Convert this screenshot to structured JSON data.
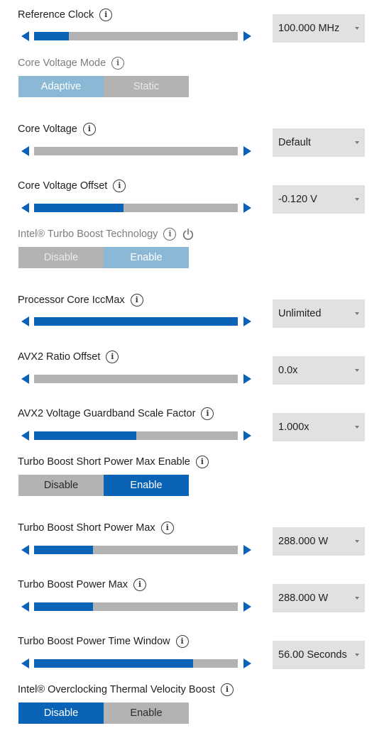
{
  "colors": {
    "accent": "#0b63b7",
    "track": "#b3b3b3",
    "select_bg": "#e1e1e1",
    "disabled_accent": "#8bb8d5"
  },
  "settings": [
    {
      "label": "Reference Clock",
      "fill": 0.17,
      "value": "100.000 MHz"
    },
    {
      "label": "Core Voltage Mode",
      "options": [
        "Adaptive",
        "Static"
      ],
      "selected": "Adaptive",
      "disabled": true
    },
    {
      "label": "Core Voltage",
      "fill": 0.0,
      "value": "Default"
    },
    {
      "label": "Core Voltage Offset",
      "fill": 0.44,
      "value": "-0.120 V"
    },
    {
      "label": "Intel® Turbo Boost Technology",
      "options": [
        "Disable",
        "Enable"
      ],
      "selected": "Enable",
      "disabled": true,
      "power_icon": "power-icon"
    },
    {
      "label": "Processor Core IccMax",
      "fill": 1.0,
      "value": "Unlimited"
    },
    {
      "label": "AVX2 Ratio Offset",
      "fill": 0.0,
      "value": "0.0x"
    },
    {
      "label": "AVX2 Voltage Guardband Scale Factor",
      "fill": 0.5,
      "value": "1.000x"
    },
    {
      "label": "Turbo Boost Short Power Max Enable",
      "options": [
        "Disable",
        "Enable"
      ],
      "selected": "Enable"
    },
    {
      "label": "Turbo Boost Short Power Max",
      "fill": 0.29,
      "value": "288.000 W"
    },
    {
      "label": "Turbo Boost Power Max",
      "fill": 0.29,
      "value": "288.000 W"
    },
    {
      "label": "Turbo Boost Power Time Window",
      "fill": 0.78,
      "value": "56.00 Seconds"
    },
    {
      "label": "Intel® Overclocking Thermal Velocity Boost",
      "options": [
        "Disable",
        "Enable"
      ],
      "selected": "Disable"
    }
  ],
  "icons": {
    "info": "info-icon",
    "arrow_left": "arrow-left-icon",
    "arrow_right": "arrow-right-icon",
    "dropdown": "chevron-down-icon",
    "power": "power-icon"
  }
}
